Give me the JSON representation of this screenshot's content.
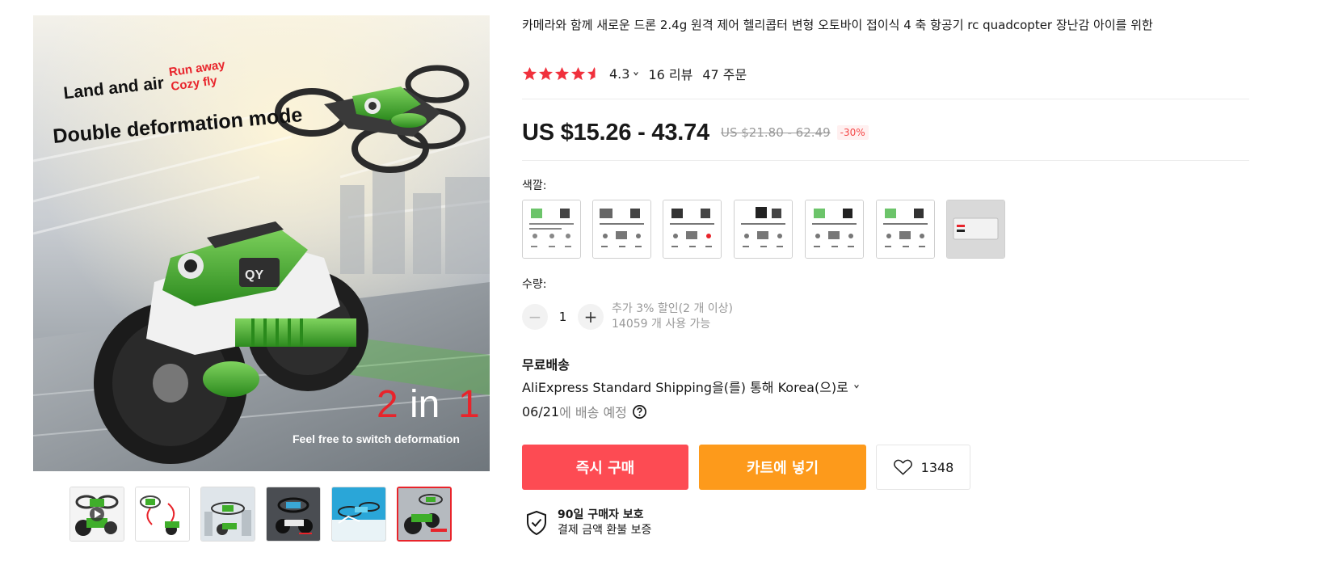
{
  "product": {
    "title": "카메라와 함께 새로운 드론 2.4g 원격 제어 헬리콥터 변형 오토바이 접이식 4 축 항공기 rc quadcopter 장난감 아이를 위한",
    "rating_value": "4.3",
    "reviews": "16 리뷰",
    "orders": "47 주문",
    "price": "US $15.26 - 43.74",
    "original_price": "US $21.80 - 62.49",
    "discount": "-30%"
  },
  "main_image": {
    "text_land": "Land and air",
    "text_run": "Run away",
    "text_cozy": "Cozy fly",
    "text_mode": "Double deformation mode",
    "text_2in1_a": "2",
    "text_2in1_b": "in",
    "text_2in1_c": "1",
    "text_switch": "Feel free to switch deformation",
    "badge_text": "QY"
  },
  "gallery": {
    "thumbnails": [
      {
        "icon": "drone-moto-video-thumb"
      },
      {
        "icon": "transform-diagram-thumb"
      },
      {
        "icon": "city-drone-thumb"
      },
      {
        "icon": "dark-transform-thumb"
      },
      {
        "icon": "blue-drone-thumb"
      },
      {
        "icon": "moto-ride-thumb",
        "active": true
      }
    ]
  },
  "color": {
    "label": "색깔:",
    "swatch_count": 7,
    "last_swatch": "battery"
  },
  "quantity": {
    "label": "수량:",
    "value": "1",
    "minus": "−",
    "plus": "+",
    "discount_note": "추가 3% 할인(2 개 이상)",
    "available": "14059 개 사용 가능"
  },
  "shipping": {
    "title": "무료배송",
    "method": "AliExpress Standard Shipping을(를) 통해 Korea(으)로",
    "date": "06/21",
    "date_suffix": "에 배송 예정"
  },
  "actions": {
    "buy_now": "즉시 구매",
    "add_to_cart": "카트에 넣기",
    "wishlist_count": "1348"
  },
  "protection": {
    "title": "90일 구매자 보호",
    "subtitle": "결제 금액 환불 보증"
  },
  "colors": {
    "buy_button": "#fd4b53",
    "cart_button": "#fd9a1b",
    "star": "#f0303c",
    "drone_green": "#3fae2a"
  }
}
